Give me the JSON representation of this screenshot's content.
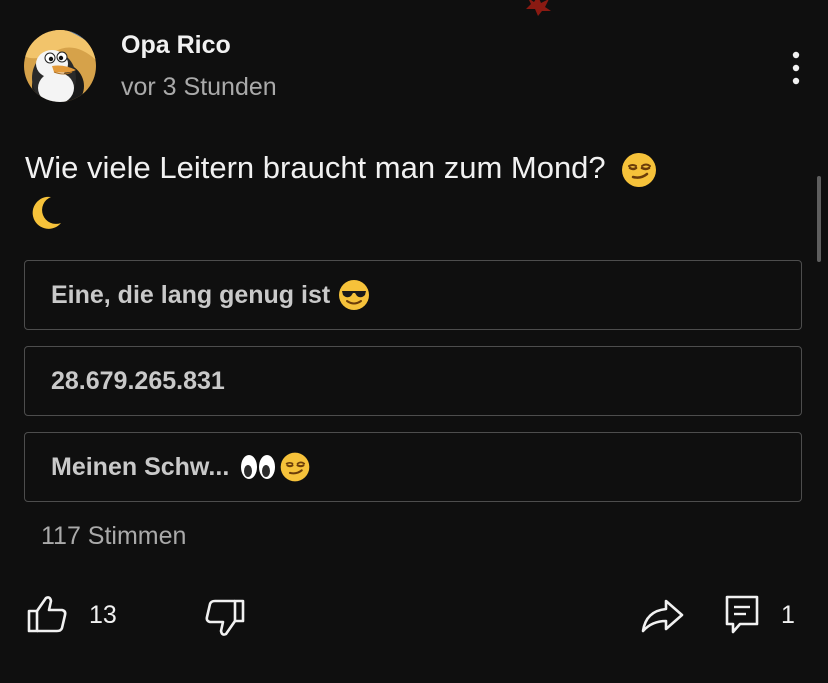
{
  "post": {
    "author": "Opa Rico",
    "time": "vor 3 Stunden",
    "question": "Wie viele Leitern braucht man zum Mond?",
    "question_emojis": [
      "smirking-face",
      "crescent-moon"
    ]
  },
  "poll": {
    "options": [
      {
        "label": "Eine, die lang genug ist",
        "emojis": [
          "sunglasses-face"
        ]
      },
      {
        "label": "28.679.265.831",
        "emojis": []
      },
      {
        "label": "Meinen Schw...",
        "emojis": [
          "eyes",
          "smirking-face"
        ]
      }
    ],
    "votes": "117 Stimmen"
  },
  "actions": {
    "likes": "13",
    "comments": "1",
    "icons": [
      "thumb-up-icon",
      "thumb-down-icon",
      "share-icon",
      "comment-icon",
      "more-vert-icon"
    ]
  },
  "colors": {
    "background": "#0f0f0f",
    "text_primary": "#f1f1f1",
    "text_secondary": "#aaaaaa",
    "option_border": "#4d4d4d"
  }
}
